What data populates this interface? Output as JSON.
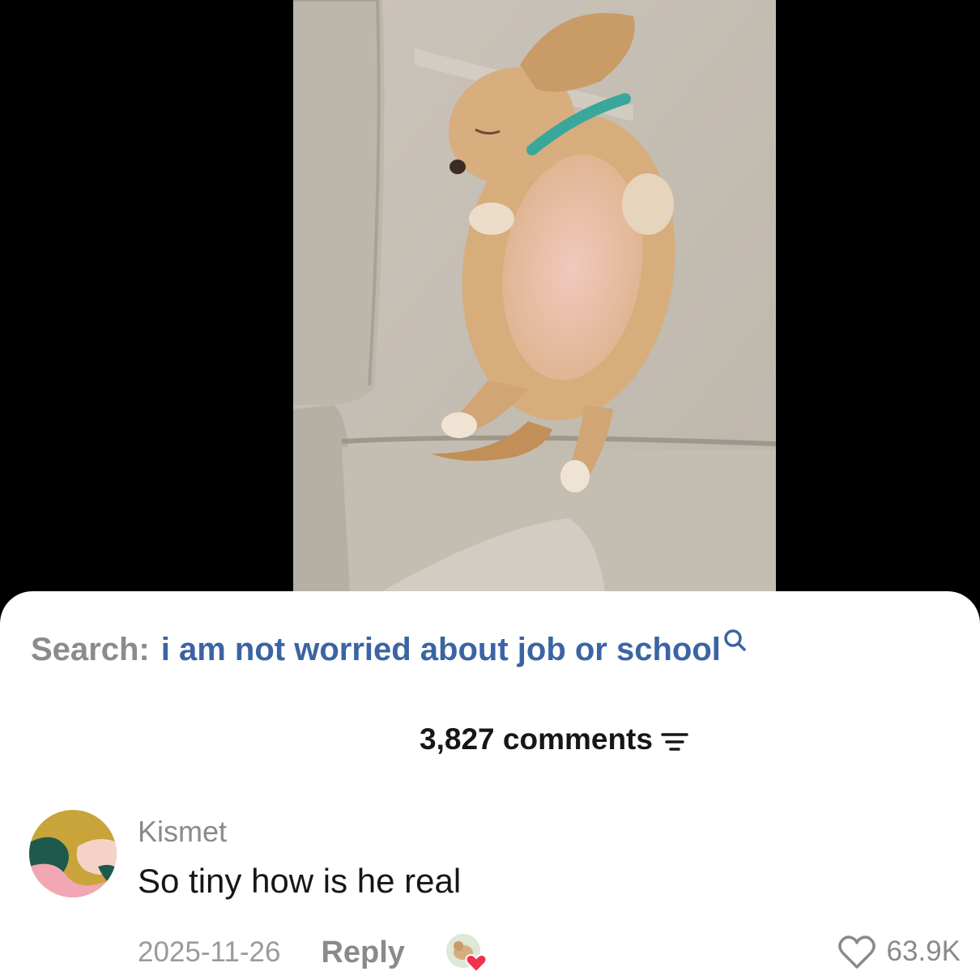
{
  "search": {
    "label": "Search:",
    "query": "i am not worried about job or school"
  },
  "comments_header": {
    "count_label": "3,827 comments"
  },
  "comment": {
    "username": "Kismet",
    "text": "So tiny how is he real",
    "date": "2025-11-26",
    "reply_label": "Reply",
    "like_count": "63.9K"
  },
  "icons": {
    "search": "search-icon",
    "sort": "sort-filter-icon",
    "heart": "heart-outline-icon",
    "creator_liked": "creator-liked-heart-icon"
  },
  "colors": {
    "search_query": "#3b64a3",
    "search_label": "#8b8b8b",
    "creator_heart": "#f0324e",
    "avatar_gold": "#c9a43a",
    "avatar_teal": "#1e5a4c",
    "avatar_pink": "#f2a7b5"
  }
}
